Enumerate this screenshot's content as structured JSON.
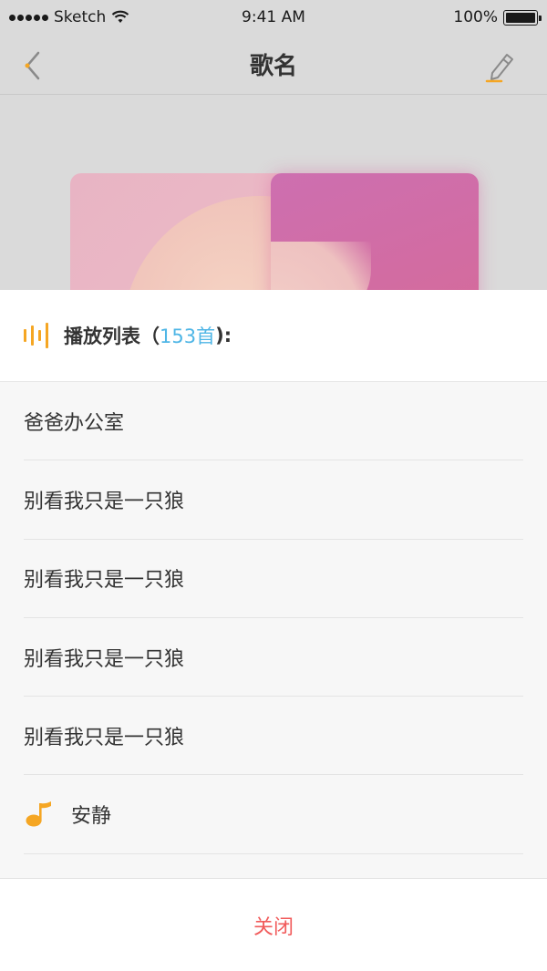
{
  "status_bar": {
    "carrier": "Sketch",
    "time": "9:41 AM",
    "battery": "100%"
  },
  "nav": {
    "title": "歌名",
    "back_icon": "chevron-left-icon",
    "edit_icon": "pencil-icon"
  },
  "playlist": {
    "title": "播放列表",
    "paren_open": "（",
    "count": "153首",
    "paren_close": "):",
    "songs": [
      {
        "title": "爸爸办公室",
        "playing": false
      },
      {
        "title": "别看我只是一只狼",
        "playing": false
      },
      {
        "title": "别看我只是一只狼",
        "playing": false
      },
      {
        "title": "别看我只是一只狼",
        "playing": false
      },
      {
        "title": "别看我只是一只狼",
        "playing": false
      },
      {
        "title": "安静",
        "playing": true
      }
    ],
    "close_label": "关闭"
  },
  "colors": {
    "accent": "#f5a623",
    "count": "#4fb6e6",
    "close": "#f15b5b"
  }
}
